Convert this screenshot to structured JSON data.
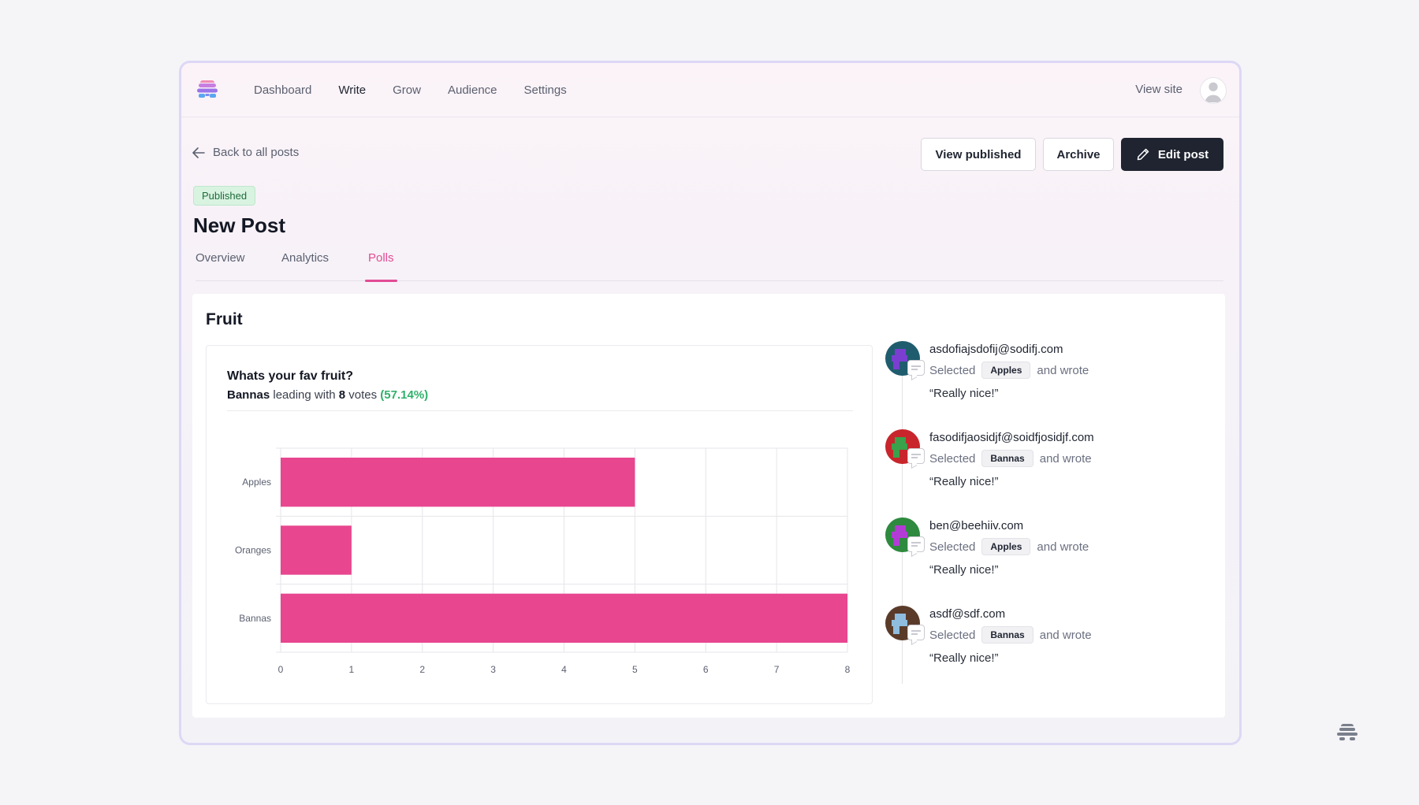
{
  "nav": {
    "items": [
      {
        "label": "Dashboard"
      },
      {
        "label": "Write"
      },
      {
        "label": "Grow"
      },
      {
        "label": "Audience"
      },
      {
        "label": "Settings"
      }
    ],
    "view_site": "View site",
    "logo_icon": "beehiiv-logo-icon",
    "avatar_icon": "user-avatar-icon"
  },
  "header": {
    "back_label": "Back to all posts",
    "view_published_label": "View published",
    "archive_label": "Archive",
    "edit_label": "Edit post",
    "status": "Published",
    "title": "New Post"
  },
  "tabs": [
    {
      "label": "Overview"
    },
    {
      "label": "Analytics"
    },
    {
      "label": "Polls"
    }
  ],
  "poll": {
    "title": "Fruit",
    "question": "Whats your fav fruit?",
    "leader": "Bannas",
    "leading_text": "leading with",
    "votes": "8",
    "votes_text": "votes",
    "percent": "(57.14%)"
  },
  "chart_data": {
    "type": "bar",
    "orientation": "horizontal",
    "categories": [
      "Apples",
      "Oranges",
      "Bannas"
    ],
    "values": [
      5,
      1,
      8
    ],
    "xlim": [
      0,
      8
    ],
    "xticks": [
      0,
      1,
      2,
      3,
      4,
      5,
      6,
      7,
      8
    ],
    "grid": true,
    "bar_color": "#e8468f"
  },
  "responses": [
    {
      "email": "asdofiajsdofij@sodifj.com",
      "selected_label": "Selected",
      "choice": "Apples",
      "wrote_label": "and wrote",
      "quote": "“Really nice!”",
      "avatar_colors": [
        "#1f5d6e",
        "#7a3fd1"
      ]
    },
    {
      "email": "fasodifjaosidjf@soidfjosidjf.com",
      "selected_label": "Selected",
      "choice": "Bannas",
      "wrote_label": "and wrote",
      "quote": "“Really nice!”",
      "avatar_colors": [
        "#c8262c",
        "#39a24a"
      ]
    },
    {
      "email": "ben@beehiiv.com",
      "selected_label": "Selected",
      "choice": "Apples",
      "wrote_label": "and wrote",
      "quote": "“Really nice!”",
      "avatar_colors": [
        "#2d8a3e",
        "#b23bd6"
      ]
    },
    {
      "email": "asdf@sdf.com",
      "selected_label": "Selected",
      "choice": "Bannas",
      "wrote_label": "and wrote",
      "quote": "“Really nice!”",
      "avatar_colors": [
        "#5a3b2a",
        "#8fbde0"
      ]
    }
  ],
  "colors": {
    "accent": "#e24b95",
    "dark_button": "#1f2430",
    "success": "#2fb16a"
  }
}
